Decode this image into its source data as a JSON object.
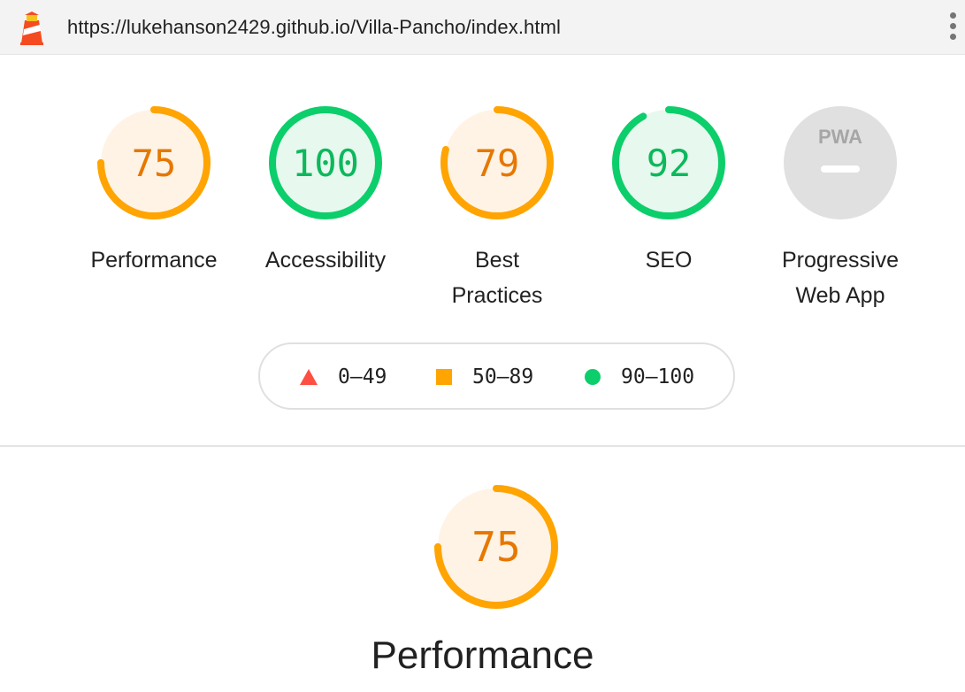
{
  "browser": {
    "url": "https://lukehanson2429.github.io/Villa-Pancho/index.html",
    "logo_icon": "lighthouse-icon",
    "menu_icon": "kebab-menu-icon"
  },
  "colors": {
    "pass": "#0cce6b",
    "average": "#ffa400",
    "fail": "#ff4e42",
    "pwa_gray": "#e0e0e0"
  },
  "gauges": [
    {
      "label": "Performance",
      "score": "75",
      "fraction": 0.75,
      "rating": "average"
    },
    {
      "label": "Accessibility",
      "score": "100",
      "fraction": 1.0,
      "rating": "pass"
    },
    {
      "label": "Best\nPractices",
      "score": "79",
      "fraction": 0.79,
      "rating": "average"
    },
    {
      "label": "SEO",
      "score": "92",
      "fraction": 0.92,
      "rating": "pass"
    },
    {
      "label": "Progressive\nWeb App",
      "badge": "PWA",
      "rating": "na"
    }
  ],
  "legend": [
    {
      "range": "0–49",
      "shape": "triangle-icon"
    },
    {
      "range": "50–89",
      "shape": "square-icon"
    },
    {
      "range": "90–100",
      "shape": "circle-icon"
    }
  ],
  "section": {
    "title": "Performance",
    "score": "75",
    "fraction": 0.75,
    "rating": "average"
  }
}
